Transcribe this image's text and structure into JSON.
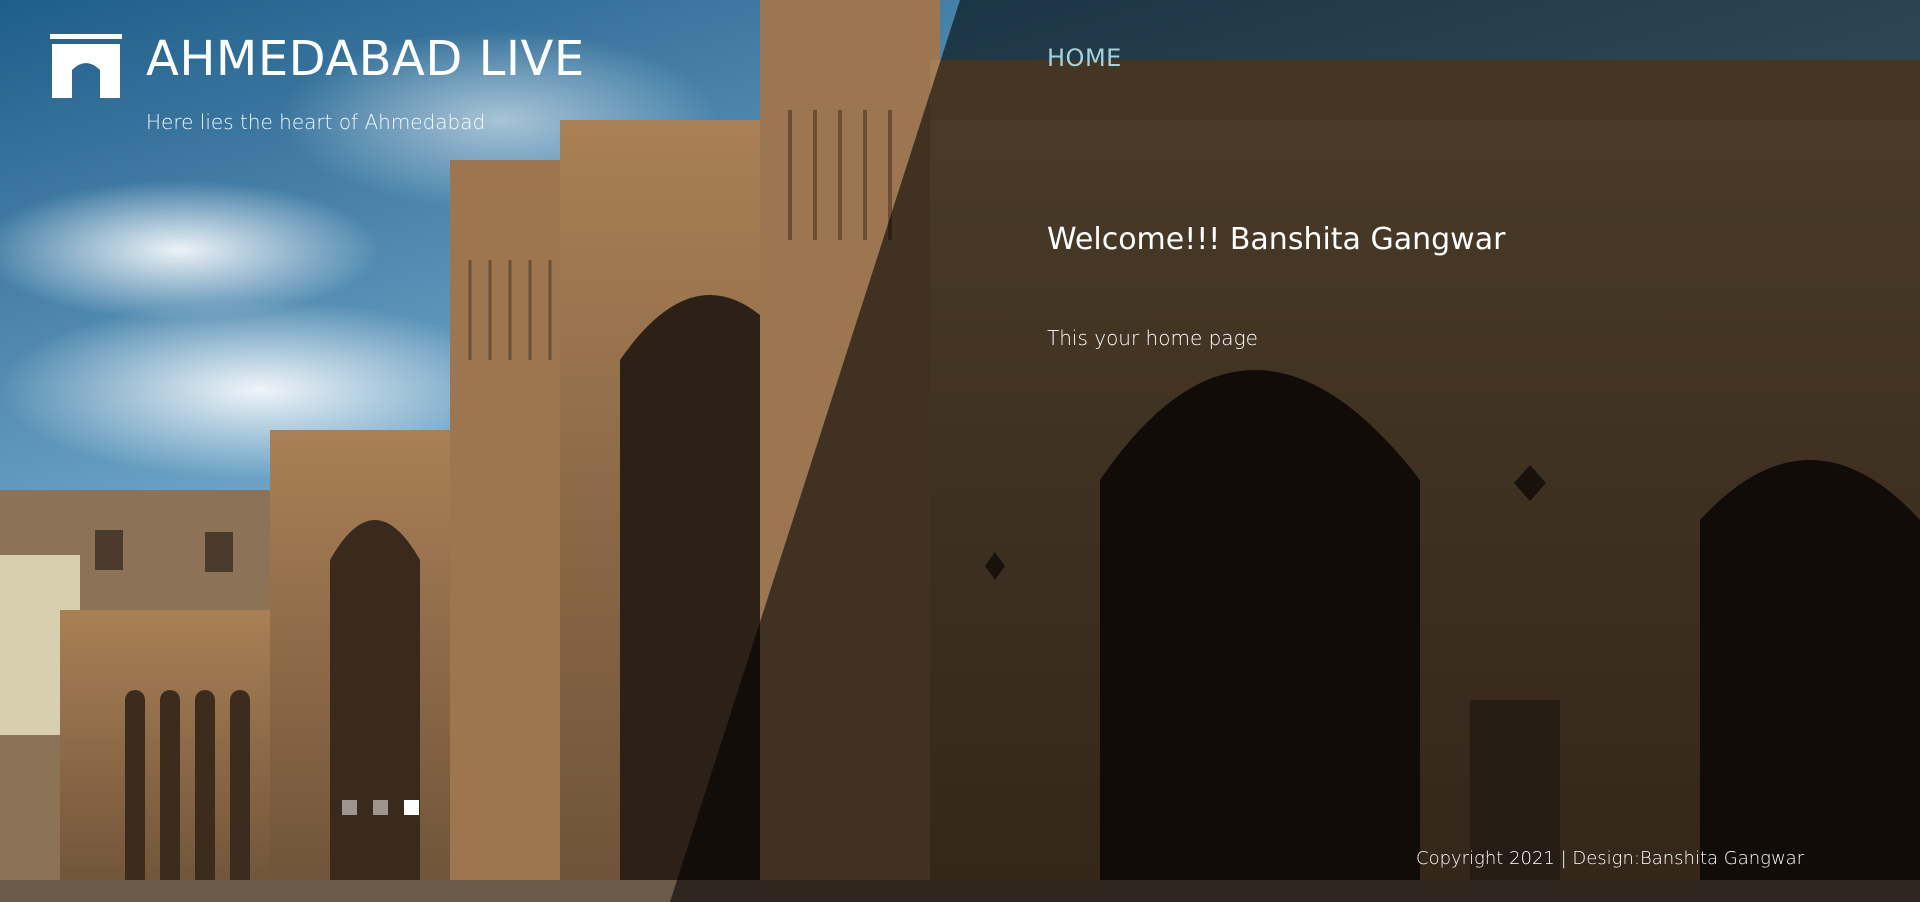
{
  "site": {
    "title": "AHMEDABAD LIVE",
    "tagline": "Here lies the heart of Ahmedabad",
    "logo_icon": "gate-arch-icon"
  },
  "nav": {
    "home_label": "HOME",
    "home_color": "#a7d3d8"
  },
  "main": {
    "welcome": "Welcome!!! Banshita Gangwar",
    "intro": "This your home page"
  },
  "slider": {
    "slide_count": 3,
    "active_index": 2
  },
  "footer": {
    "copyright": "Copyright 2021 | Design:Banshita Gangwar"
  },
  "colors": {
    "overlay": "#000000",
    "sky_top": "#2e6e99",
    "stone": "#8a6a49"
  }
}
